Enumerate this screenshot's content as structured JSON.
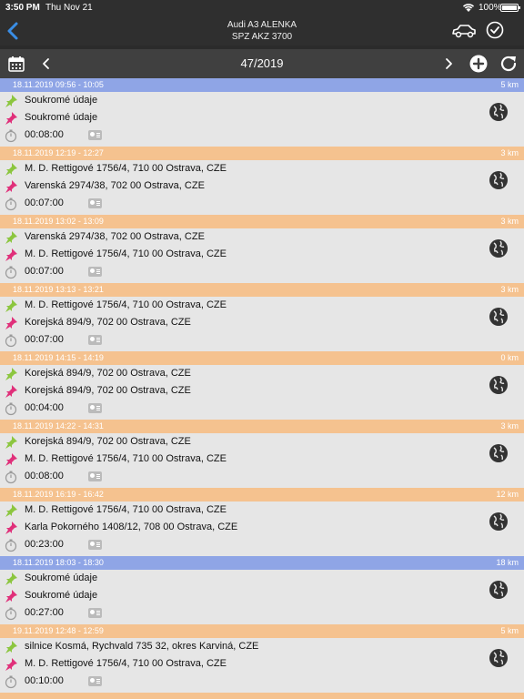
{
  "status_bar": {
    "time": "3:50 PM",
    "date": "Thu Nov 21",
    "battery": "100%"
  },
  "nav": {
    "title_line1": "Audi A3 ALENKA",
    "title_line2": "SPZ AKZ 3700",
    "icons": [
      "back-chevron-icon",
      "car-icon",
      "checkmark-circle-icon"
    ]
  },
  "week_bar": {
    "label": "47/2019",
    "icons": [
      "calendar-icon",
      "chevron-left-icon",
      "chevron-right-icon",
      "add-circle-icon",
      "refresh-icon"
    ]
  },
  "colors": {
    "header_blue": "#8fa5e6",
    "header_orange": "#f5c28f",
    "pin_start": "#8cc63f",
    "pin_end": "#e0307a"
  },
  "trips": [
    {
      "time": "18.11.2019 09:56 - 10:05",
      "distance": "5 km",
      "color": "blue",
      "from": "Soukromé údaje",
      "to": "Soukromé údaje",
      "duration": "00:08:00"
    },
    {
      "time": "18.11.2019 12:19 - 12:27",
      "distance": "3 km",
      "color": "orange",
      "from": "M. D. Rettigové 1756/4, 710 00 Ostrava, CZE",
      "to": "Varenská 2974/38, 702 00 Ostrava, CZE",
      "duration": "00:07:00"
    },
    {
      "time": "18.11.2019 13:02 - 13:09",
      "distance": "3 km",
      "color": "orange",
      "from": "Varenská 2974/38, 702 00 Ostrava, CZE",
      "to": "M. D. Rettigové 1756/4, 710 00 Ostrava, CZE",
      "duration": "00:07:00"
    },
    {
      "time": "18.11.2019 13:13 - 13:21",
      "distance": "3 km",
      "color": "orange",
      "from": "M. D. Rettigové 1756/4, 710 00 Ostrava, CZE",
      "to": "Korejská 894/9, 702 00 Ostrava, CZE",
      "duration": "00:07:00"
    },
    {
      "time": "18.11.2019 14:15 - 14:19",
      "distance": "0 km",
      "color": "orange",
      "from": "Korejská 894/9, 702 00 Ostrava, CZE",
      "to": "Korejská 894/9, 702 00 Ostrava, CZE",
      "duration": "00:04:00"
    },
    {
      "time": "18.11.2019 14:22 - 14:31",
      "distance": "3 km",
      "color": "orange",
      "from": "Korejská 894/9, 702 00 Ostrava, CZE",
      "to": "M. D. Rettigové 1756/4, 710 00 Ostrava, CZE",
      "duration": "00:08:00"
    },
    {
      "time": "18.11.2019 16:19 - 16:42",
      "distance": "12 km",
      "color": "orange",
      "from": "M. D. Rettigové 1756/4, 710 00 Ostrava, CZE",
      "to": "Karla Pokorného 1408/12, 708 00 Ostrava, CZE",
      "duration": "00:23:00"
    },
    {
      "time": "18.11.2019 18:03 - 18:30",
      "distance": "18 km",
      "color": "blue",
      "from": "Soukromé údaje",
      "to": "Soukromé údaje",
      "duration": "00:27:00"
    },
    {
      "time": "19.11.2019 12:48 - 12:59",
      "distance": "5 km",
      "color": "orange",
      "from": "silnice Kosmá, Rychvald 735 32, okres Karviná, CZE",
      "to": "M. D. Rettigové 1756/4, 710 00 Ostrava, CZE",
      "duration": "00:10:00"
    }
  ]
}
